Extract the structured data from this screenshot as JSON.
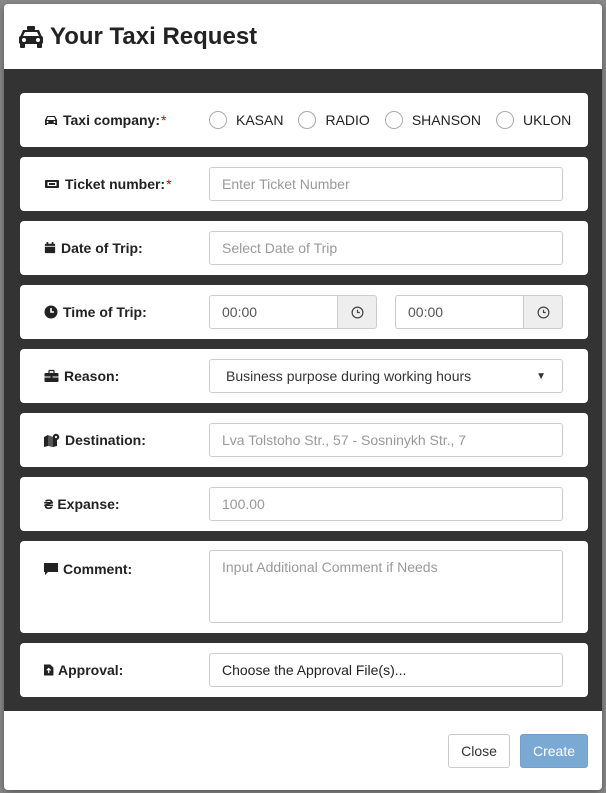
{
  "modal": {
    "title": "Your Taxi Request",
    "title_icon": "taxi-icon"
  },
  "form": {
    "taxi_company": {
      "label": "Taxi company:",
      "required_mark": "*",
      "icon": "car-icon",
      "options": [
        "KASAN",
        "RADIO",
        "SHANSON",
        "UKLON"
      ]
    },
    "ticket_number": {
      "label": "Ticket number:",
      "required_mark": "*",
      "icon": "ticket-icon",
      "placeholder": "Enter Ticket Number"
    },
    "date_of_trip": {
      "label": "Date of Trip:",
      "icon": "calendar-icon",
      "placeholder": "Select Date of Trip"
    },
    "time_of_trip": {
      "label": "Time of Trip:",
      "icon": "clock-icon",
      "from_value": "00:00",
      "to_value": "00:00"
    },
    "reason": {
      "label": "Reason:",
      "icon": "briefcase-icon",
      "selected": "Business purpose during working hours"
    },
    "destination": {
      "label": "Destination:",
      "icon": "map-marker-icon",
      "placeholder": "Lva Tolstoho Str., 57 - Sosninykh Str., 7"
    },
    "expanse": {
      "label": "Expanse:",
      "icon": "hryvnia-icon",
      "currency_symbol": "₴",
      "placeholder": "100.00"
    },
    "comment": {
      "label": "Comment:",
      "icon": "comment-icon",
      "placeholder": "Input Additional Comment if Needs"
    },
    "approval": {
      "label": "Approval:",
      "icon": "file-upload-icon",
      "button_text": "Choose the Approval File(s)..."
    }
  },
  "footer": {
    "close_label": "Close",
    "create_label": "Create"
  },
  "colors": {
    "body_bg": "#333333",
    "primary_btn": "#7aa9d4",
    "required": "#cc0000"
  }
}
